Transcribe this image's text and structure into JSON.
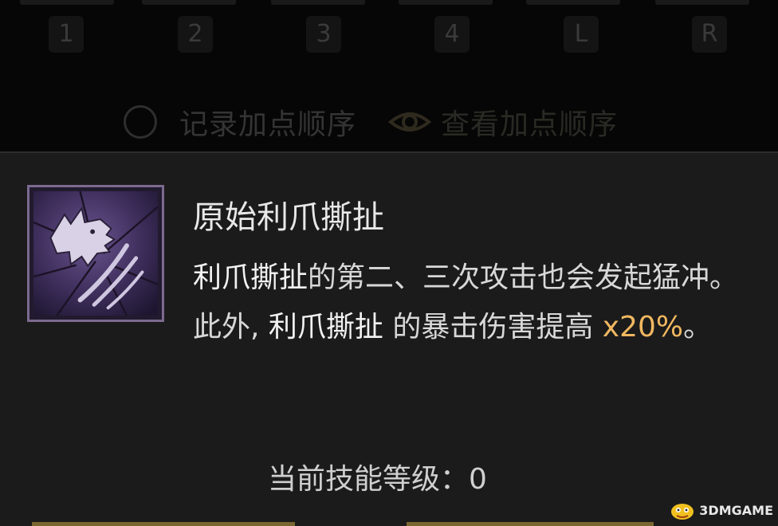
{
  "skill_slots": [
    "1",
    "2",
    "3",
    "4",
    "L",
    "R"
  ],
  "top_actions": {
    "record_order_label": "记录加点顺序",
    "view_order_label": "查看加点顺序"
  },
  "tooltip": {
    "skill_name": "原始利爪撕扯",
    "description": {
      "skill_ref_1": "利爪撕扯",
      "text_1": "的第二、三次攻击也会发起猛冲。此外, ",
      "skill_ref_2": "利爪撕扯",
      "text_2": " 的暴击伤害提高 ",
      "bonus_value": "x20%",
      "text_3": "。"
    },
    "level_label": "当前技能等级：",
    "level_value": "0"
  },
  "watermark": {
    "text": "3DMGAME"
  },
  "colors": {
    "panel_bg": "#1b1b1b",
    "accent_gold": "#f0b860",
    "icon_border": "#7c6a8f"
  }
}
